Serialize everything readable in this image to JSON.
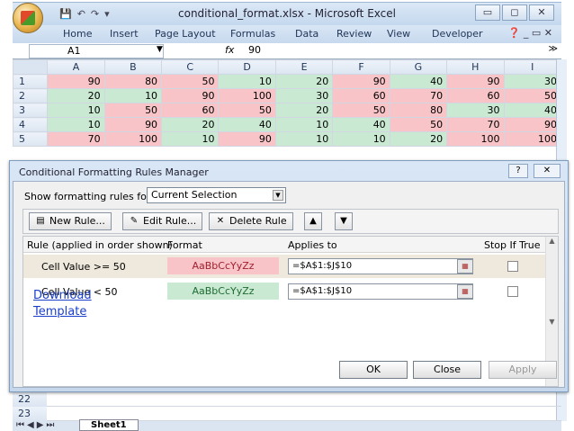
{
  "window": {
    "title": "conditional_format.xlsx - Microsoft Excel",
    "minimize_label": "▭",
    "restore_label": "◻",
    "close_label": "✕"
  },
  "ribbon": {
    "tabs": [
      "Home",
      "Insert",
      "Page Layout",
      "Formulas",
      "Data",
      "Review",
      "View",
      "Developer"
    ]
  },
  "formula_bar": {
    "name_box": "A1",
    "fx_label": "fx",
    "value": "90"
  },
  "grid": {
    "columns": [
      "A",
      "B",
      "C",
      "D",
      "E",
      "F",
      "G",
      "H",
      "I"
    ],
    "rows": [
      {
        "num": "1",
        "cells": [
          90,
          80,
          50,
          10,
          20,
          90,
          40,
          90,
          30
        ]
      },
      {
        "num": "2",
        "cells": [
          20,
          10,
          90,
          100,
          30,
          60,
          70,
          60,
          50
        ]
      },
      {
        "num": "3",
        "cells": [
          10,
          50,
          60,
          50,
          20,
          50,
          80,
          30,
          40
        ]
      },
      {
        "num": "4",
        "cells": [
          10,
          90,
          20,
          40,
          10,
          40,
          50,
          70,
          90
        ]
      },
      {
        "num": "5",
        "cells": [
          70,
          100,
          10,
          90,
          10,
          10,
          20,
          100,
          100
        ]
      }
    ],
    "highlight_colors": {
      "red": "#f8c4c7",
      "green": "#c9e9d2"
    }
  },
  "dialog": {
    "title": "Conditional Formatting Rules Manager",
    "help_label": "?",
    "close_label": "✕",
    "show_rules_label": "Show formatting rules for:",
    "show_rules_value": "Current Selection",
    "new_rule": "New Rule...",
    "edit_rule": "Edit Rule...",
    "delete_rule": "Delete Rule",
    "headers": {
      "rule": "Rule (applied in order shown)",
      "format": "Format",
      "applies": "Applies to",
      "stop": "Stop If True"
    },
    "rules": [
      {
        "text": "Cell Value >= 50",
        "format_preview": "AaBbCcYyZz",
        "applies_to": "=$A$1:$J$10",
        "stop_if_true": false
      },
      {
        "text": "Cell Value < 50",
        "format_preview": "AaBbCcYyZz",
        "applies_to": "=$A$1:$J$10",
        "stop_if_true": false
      }
    ],
    "ok": "OK",
    "close": "Close",
    "apply": "Apply"
  },
  "link": {
    "line1": "Download",
    "line2": "Template"
  },
  "lower_rows": [
    "22",
    "23"
  ],
  "sheet_tab": "Sheet1"
}
